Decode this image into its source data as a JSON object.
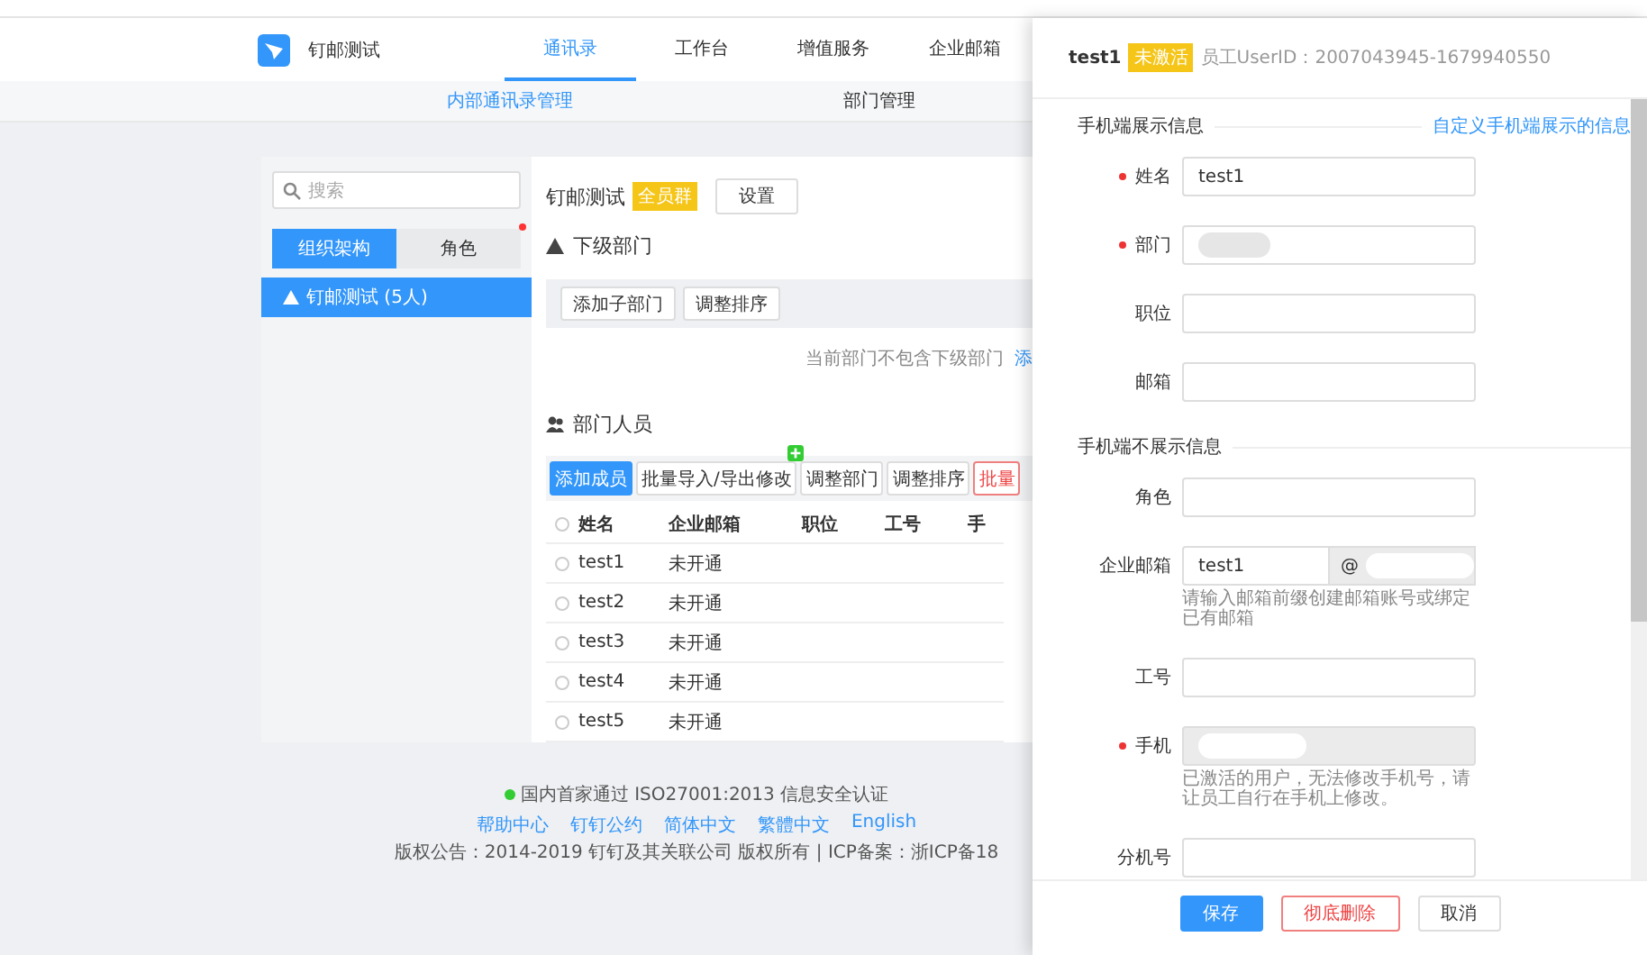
{
  "app": {
    "name": "钉邮测试"
  },
  "nav": [
    {
      "label": "通讯录",
      "selected": true
    },
    {
      "label": "工作台",
      "selected": false
    },
    {
      "label": "增值服务",
      "selected": false
    },
    {
      "label": "企业邮箱",
      "selected": false
    }
  ],
  "subnav": [
    {
      "label": "内部通讯录管理",
      "selected": true
    },
    {
      "label": "部门管理",
      "selected": false
    }
  ],
  "sidebar": {
    "search": {
      "placeholder": "搜索"
    },
    "tabs": [
      {
        "label": "组织架构",
        "selected": true,
        "dot": false
      },
      {
        "label": "角色",
        "selected": false,
        "dot": true
      }
    ],
    "tree": [
      {
        "label": "钉邮测试 (5人)",
        "selected": true
      }
    ]
  },
  "department": {
    "title": "钉邮测试",
    "badge": "全员群",
    "settings_button": "设置",
    "sub_heading": "下级部门",
    "sub_buttons": [
      "添加子部门",
      "调整排序"
    ],
    "empty_note": "当前部门不包含下级部门",
    "empty_link": "添",
    "members_heading": "部门人员",
    "member_buttons": [
      {
        "label": "添加成员",
        "kind": "primary",
        "new_badge": false
      },
      {
        "label": "批量导入/导出修改",
        "kind": "default",
        "new_badge": true
      },
      {
        "label": "调整部门",
        "kind": "default",
        "new_badge": false
      },
      {
        "label": "调整排序",
        "kind": "default",
        "new_badge": false
      },
      {
        "label": "批量",
        "kind": "danger",
        "new_badge": false
      }
    ],
    "table": {
      "select_all_checked": false,
      "columns": [
        "姓名",
        "企业邮箱",
        "职位",
        "工号",
        "手"
      ],
      "rows": [
        {
          "checked": false,
          "cells": [
            "test1",
            "未开通"
          ]
        },
        {
          "checked": false,
          "cells": [
            "test2",
            "未开通"
          ]
        },
        {
          "checked": false,
          "cells": [
            "test3",
            "未开通"
          ]
        },
        {
          "checked": false,
          "cells": [
            "test4",
            "未开通"
          ]
        },
        {
          "checked": false,
          "cells": [
            "test5",
            "未开通"
          ]
        }
      ]
    }
  },
  "footer": {
    "certification": "国内首家通过 ISO27001:2013 信息安全认证",
    "links": [
      "帮助中心",
      "钉钉公约",
      "简体中文",
      "繁體中文",
      "English"
    ],
    "copyright": "版权公告：2014-2019 钉钉及其关联公司 版权所有 | ICP备案：浙ICP备18"
  },
  "drawer": {
    "name": "test1",
    "status": "未激活",
    "user_id": "员工UserID：2007043945-1679940550",
    "sections": [
      {
        "title": "手机端展示信息",
        "link": "自定义手机端展示的信息",
        "fields": [
          {
            "label": "姓名",
            "required": true,
            "kind": "text",
            "value": "test1",
            "redacted": false,
            "disabled": false
          },
          {
            "label": "部门",
            "required": true,
            "kind": "text",
            "redacted": true,
            "disabled": false
          },
          {
            "label": "职位",
            "required": false,
            "kind": "text",
            "redacted": false,
            "disabled": false
          },
          {
            "label": "邮箱",
            "required": false,
            "kind": "text",
            "redacted": false,
            "disabled": false
          }
        ]
      },
      {
        "title": "手机端不展示信息",
        "fields": [
          {
            "label": "角色",
            "required": false,
            "kind": "text",
            "redacted": false,
            "disabled": false
          },
          {
            "label": "企业邮箱",
            "required": false,
            "kind": "email",
            "value": "test1",
            "suffix": "@",
            "redacted": true,
            "disabled": false,
            "hint": "请输入邮箱前缀创建邮箱账号或绑定已有邮箱"
          },
          {
            "label": "工号",
            "required": false,
            "kind": "text",
            "redacted": false,
            "disabled": false
          },
          {
            "label": "手机",
            "required": true,
            "kind": "text",
            "redacted": true,
            "disabled": true,
            "hint": "已激活的用户，无法修改手机号，请让员工自行在手机上修改。"
          },
          {
            "label": "分机号",
            "required": false,
            "kind": "text",
            "redacted": false,
            "disabled": false
          }
        ]
      }
    ],
    "buttons": [
      {
        "label": "保存",
        "kind": "primary"
      },
      {
        "label": "彻底删除",
        "kind": "danger"
      },
      {
        "label": "取消",
        "kind": "default"
      }
    ]
  }
}
